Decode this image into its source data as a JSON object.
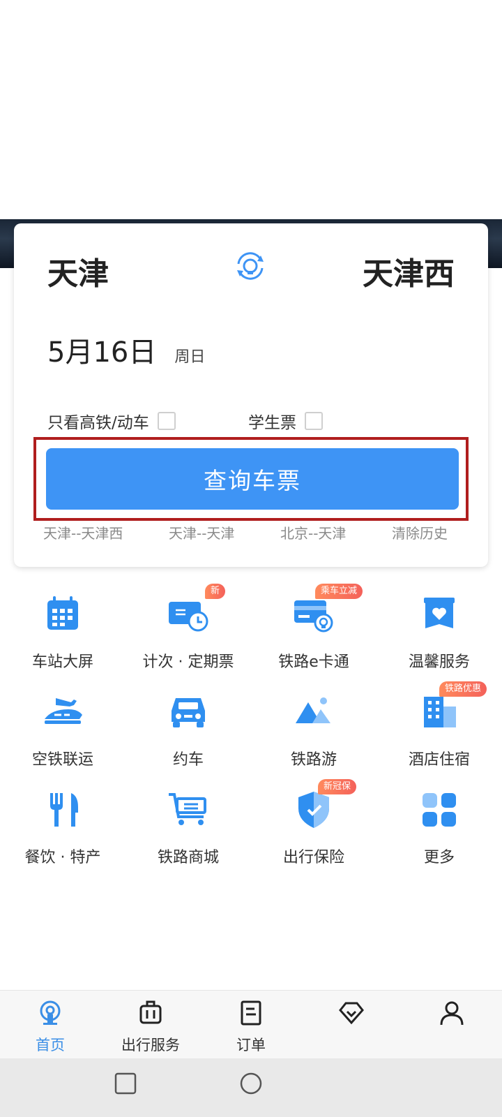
{
  "search": {
    "from_station": "天津",
    "to_station": "天津西",
    "date": "5月16日",
    "weekday": "周日",
    "option_high_speed": "只看高铁/动车",
    "option_student": "学生票",
    "search_button": "查询车票",
    "history": [
      "天津--天津西",
      "天津--天津",
      "北京--天津"
    ],
    "clear_history": "清除历史"
  },
  "services": [
    {
      "label": "车站大屏",
      "icon": "calendar-screen-icon",
      "badge": ""
    },
    {
      "label": "计次 · 定期票",
      "icon": "ticket-clock-icon",
      "badge": "新"
    },
    {
      "label": "铁路e卡通",
      "icon": "railway-card-icon",
      "badge": "乘车立减"
    },
    {
      "label": "温馨服务",
      "icon": "heart-service-icon",
      "badge": ""
    },
    {
      "label": "空铁联运",
      "icon": "plane-train-icon",
      "badge": ""
    },
    {
      "label": "约车",
      "icon": "car-icon",
      "badge": ""
    },
    {
      "label": "铁路游",
      "icon": "mountain-icon",
      "badge": ""
    },
    {
      "label": "酒店住宿",
      "icon": "hotel-icon",
      "badge": "铁路优惠"
    },
    {
      "label": "餐饮 · 特产",
      "icon": "fork-knife-icon",
      "badge": ""
    },
    {
      "label": "铁路商城",
      "icon": "shopping-cart-icon",
      "badge": ""
    },
    {
      "label": "出行保险",
      "icon": "shield-icon",
      "badge": "新冠保"
    },
    {
      "label": "更多",
      "icon": "grid-more-icon",
      "badge": ""
    }
  ],
  "bottom_nav": [
    {
      "label": "首页",
      "icon": "railway-logo-icon",
      "active": true
    },
    {
      "label": "出行服务",
      "icon": "luggage-icon",
      "active": false
    },
    {
      "label": "订单",
      "icon": "order-doc-icon",
      "active": false
    },
    {
      "label": "",
      "icon": "diamond-icon",
      "active": false
    },
    {
      "label": "",
      "icon": "user-icon",
      "active": false
    }
  ],
  "colors": {
    "primary": "#3e94f5",
    "icon_blue": "#2f8ff0",
    "highlight_border": "#b01e1e",
    "badge": "#f4615a"
  }
}
